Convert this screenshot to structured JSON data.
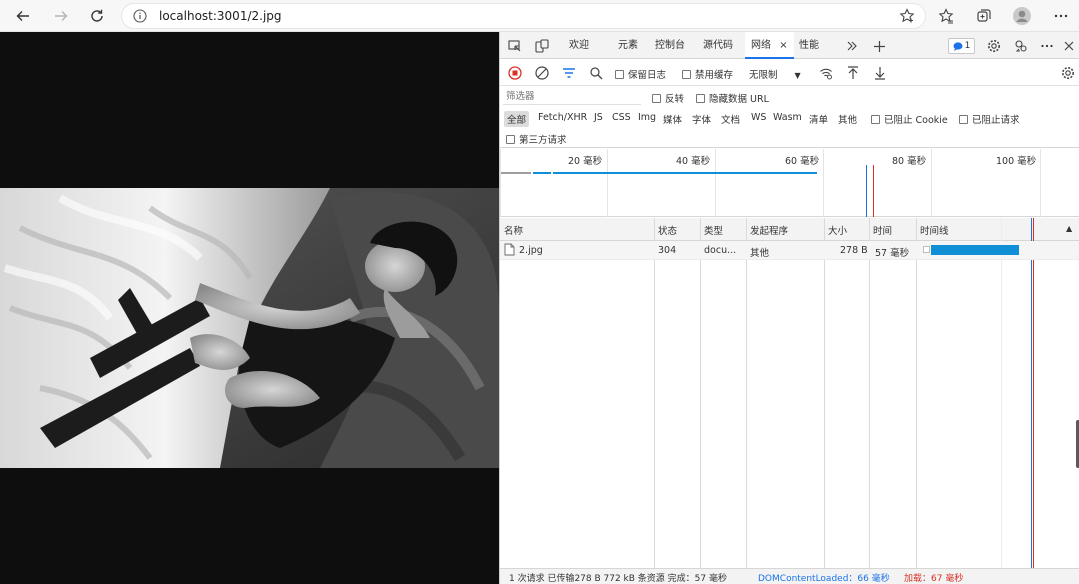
{
  "browser": {
    "url": "localhost:3001/2.jpg"
  },
  "devtools": {
    "tabs": [
      {
        "label": "欢迎"
      },
      {
        "label": "元素"
      },
      {
        "label": "控制台"
      },
      {
        "label": "源代码"
      },
      {
        "label": "网络",
        "close": "×"
      },
      {
        "label": "性能"
      }
    ],
    "message_count": "1",
    "network_toolbar": {
      "preserve_log": "保留日志",
      "disable_cache": "禁用缓存",
      "throttling": "无限制"
    },
    "filter": {
      "placeholder": "筛选器",
      "invert": "反转",
      "hide_data_urls": "隐藏数据 URL",
      "types": [
        "全部",
        "Fetch/XHR",
        "JS",
        "CSS",
        "Img",
        "媒体",
        "字体",
        "文档",
        "WS",
        "Wasm",
        "清单",
        "其他"
      ],
      "blocked_cookies": "已阻止 Cookie",
      "blocked_requests": "已阻止请求",
      "third_party": "第三方请求"
    },
    "overview_ticks": [
      "20 毫秒",
      "40 毫秒",
      "60 毫秒",
      "80 毫秒",
      "100 毫秒"
    ],
    "columns": [
      "名称",
      "状态",
      "类型",
      "发起程序",
      "大小",
      "时间",
      "时间线"
    ],
    "rows": [
      {
        "name": "2.jpg",
        "status": "304",
        "type": "docu...",
        "initiator": "其他",
        "size": "278 B",
        "time": "57 毫秒"
      }
    ],
    "status_bar": {
      "summary": "1 次请求  已传输278 B  772 kB 条资源  完成：57 毫秒",
      "dom_content_loaded": "DOMContentLoaded：66 毫秒",
      "load": "加载：67 毫秒"
    }
  },
  "colors": {
    "accent": "#1a73e8",
    "timeline_bar": "#0f8fd6",
    "record_red": "#d93025",
    "dcl_blue": "#1a73e8",
    "load_red": "#d93025"
  }
}
